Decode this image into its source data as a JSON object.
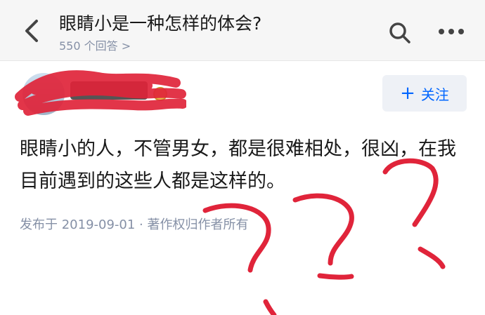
{
  "header": {
    "title": "眼睛小是一种怎样的体会?",
    "subtitle": "550 个回答 >",
    "back_icon": "chevron-left-icon",
    "search_icon": "search-icon",
    "more_icon": "more-horizontal-icon"
  },
  "author": {
    "name": "",
    "badge_icon": "badge-icon",
    "follow_label": "关注",
    "follow_plus": "+"
  },
  "answer": {
    "text": "眼睛小的人，不管男女，都是很难相处，很凶，在我目前遇到的这些人都是这样的。",
    "meta": "发布于 2019-09-01 · 著作权归作者所有"
  },
  "colors": {
    "accent": "#0066ff",
    "scribble": "#e0243a",
    "muted_text": "#8590a6",
    "header_bg": "#f6f6f6"
  }
}
